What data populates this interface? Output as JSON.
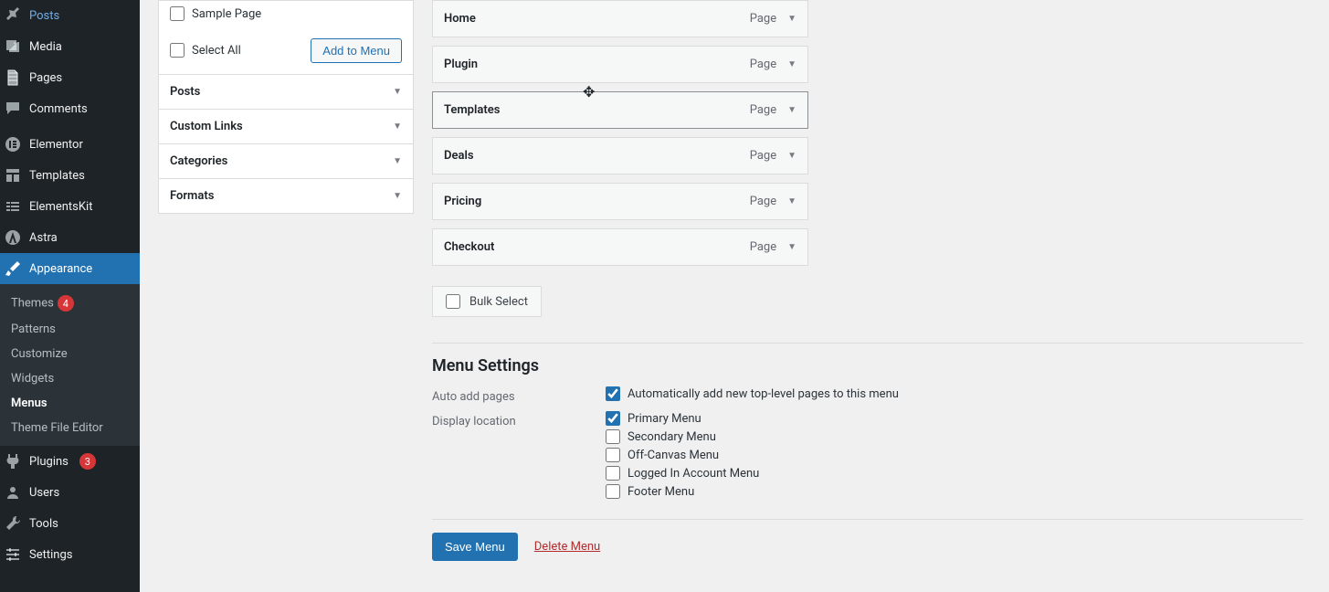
{
  "sidebar": {
    "items": [
      {
        "label": "Posts"
      },
      {
        "label": "Media"
      },
      {
        "label": "Pages"
      },
      {
        "label": "Comments"
      },
      {
        "label": "Elementor"
      },
      {
        "label": "Templates"
      },
      {
        "label": "ElementsKit"
      },
      {
        "label": "Astra"
      },
      {
        "label": "Appearance"
      },
      {
        "label": "Plugins",
        "badge": "3"
      },
      {
        "label": "Users"
      },
      {
        "label": "Tools"
      },
      {
        "label": "Settings"
      }
    ],
    "sub": [
      {
        "label": "Themes",
        "badge": "4"
      },
      {
        "label": "Patterns"
      },
      {
        "label": "Customize"
      },
      {
        "label": "Widgets"
      },
      {
        "label": "Menus"
      },
      {
        "label": "Theme File Editor"
      }
    ]
  },
  "left": {
    "sample_page": "Sample Page",
    "select_all": "Select All",
    "add_to_menu": "Add to Menu",
    "sections": [
      "Posts",
      "Custom Links",
      "Categories",
      "Formats"
    ]
  },
  "menu": {
    "items": [
      {
        "label": "Home",
        "type": "Page"
      },
      {
        "label": "Plugin",
        "type": "Page"
      },
      {
        "label": "Templates",
        "type": "Page"
      },
      {
        "label": "Deals",
        "type": "Page"
      },
      {
        "label": "Pricing",
        "type": "Page"
      },
      {
        "label": "Checkout",
        "type": "Page"
      }
    ],
    "bulk": "Bulk Select"
  },
  "settings": {
    "title": "Menu Settings",
    "auto_label": "Auto add pages",
    "auto_opt": "Automatically add new top-level pages to this menu",
    "loc_label": "Display location",
    "locs": [
      "Primary Menu",
      "Secondary Menu",
      "Off-Canvas Menu",
      "Logged In Account Menu",
      "Footer Menu"
    ]
  },
  "footer": {
    "save": "Save Menu",
    "delete": "Delete Menu"
  }
}
